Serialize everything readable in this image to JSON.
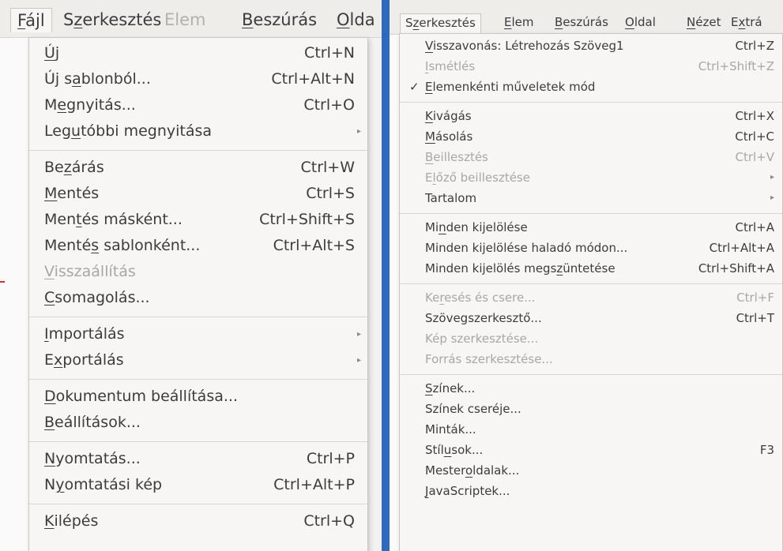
{
  "left": {
    "menubar": [
      {
        "label": "Fájl",
        "u": "F",
        "state": "active"
      },
      {
        "label": "Szerkesztés",
        "u": "z",
        "state": "normal"
      },
      {
        "label": "Elem",
        "u": "",
        "state": "dim"
      },
      {
        "label": "Beszúrás",
        "u": "B",
        "state": "normal"
      },
      {
        "label": "Olda",
        "u": "O",
        "state": "normal"
      }
    ],
    "menu": [
      {
        "label": "Új",
        "u": "Ú",
        "sc": "Ctrl+N"
      },
      {
        "label": "Új sablonból...",
        "u": "a",
        "sc": "Ctrl+Alt+N"
      },
      {
        "label": "Megnyitás...",
        "u": "e",
        "sc": "Ctrl+O"
      },
      {
        "label": "Legutóbbi megnyitása",
        "u": "u",
        "sub": true
      },
      {
        "sep": true
      },
      {
        "label": "Bezárás",
        "u": "z",
        "sc": "Ctrl+W"
      },
      {
        "label": "Mentés",
        "u": "M",
        "sc": "Ctrl+S"
      },
      {
        "label": "Mentés másként...",
        "u": "t",
        "sc": "Ctrl+Shift+S"
      },
      {
        "label": "Mentés sablonként...",
        "u": "s",
        "sc": "Ctrl+Alt+S"
      },
      {
        "label": "Visszaállítás",
        "u": "V",
        "disabled": true
      },
      {
        "label": "Csomagolás...",
        "u": "C"
      },
      {
        "sep": true
      },
      {
        "label": "Importálás",
        "u": "I",
        "sub": true
      },
      {
        "label": "Exportálás",
        "u": "x",
        "sub": true
      },
      {
        "sep": true
      },
      {
        "label": "Dokumentum beállítása...",
        "u": "D"
      },
      {
        "label": "Beállítások...",
        "u": "B"
      },
      {
        "sep": true
      },
      {
        "label": "Nyomtatás...",
        "u": "N",
        "sc": "Ctrl+P"
      },
      {
        "label": "Nyomtatási kép",
        "u": "y",
        "sc": "Ctrl+Alt+P"
      },
      {
        "sep": true
      },
      {
        "label": "Kilépés",
        "u": "K",
        "sc": "Ctrl+Q"
      }
    ]
  },
  "right": {
    "menubar": [
      {
        "label": "Szerkesztés",
        "u": "z",
        "state": "active"
      },
      {
        "label": "Elem",
        "u": "E",
        "state": "normal"
      },
      {
        "label": "Beszúrás",
        "u": "B",
        "state": "normal"
      },
      {
        "label": "Oldal",
        "u": "O",
        "state": "normal"
      },
      {
        "label": "Nézet",
        "u": "N",
        "state": "normal"
      },
      {
        "label": "Extrá",
        "u": "x",
        "state": "normal"
      }
    ],
    "menu": [
      {
        "label": "Visszavonás: Létrehozás Szöveg1",
        "u": "V",
        "sc": "Ctrl+Z"
      },
      {
        "label": "Ismétlés",
        "u": "I",
        "sc": "Ctrl+Shift+Z",
        "disabled": true
      },
      {
        "label": "Elemenkénti műveletek mód",
        "u": "E",
        "check": true
      },
      {
        "sep": true
      },
      {
        "label": "Kivágás",
        "u": "K",
        "sc": "Ctrl+X"
      },
      {
        "label": "Másolás",
        "u": "M",
        "sc": "Ctrl+C"
      },
      {
        "label": "Beillesztés",
        "u": "B",
        "sc": "Ctrl+V",
        "disabled": true
      },
      {
        "label": "Előző beillesztése",
        "u": "l",
        "disabled": true,
        "sub": true
      },
      {
        "label": "Tartalom",
        "u": "",
        "sub": true
      },
      {
        "sep": true
      },
      {
        "label": "Minden kijelölése",
        "u": "n",
        "sc": "Ctrl+A"
      },
      {
        "label": "Minden kijelölése haladó módon...",
        "u": "",
        "sc": "Ctrl+Alt+A"
      },
      {
        "label": "Minden kijelölés megszüntetése",
        "u": "z",
        "sc": "Ctrl+Shift+A"
      },
      {
        "sep": true
      },
      {
        "label": "Keresés és csere...",
        "u": "r",
        "sc": "Ctrl+F",
        "disabled": true
      },
      {
        "label": "Szövegszerkesztő...",
        "u": "",
        "sc": "Ctrl+T"
      },
      {
        "label": "Kép szerkesztése...",
        "u": "",
        "disabled": true
      },
      {
        "label": "Forrás szerkesztése...",
        "u": "",
        "disabled": true
      },
      {
        "sep": true
      },
      {
        "label": "Színek...",
        "u": "S"
      },
      {
        "label": "Színek cseréje...",
        "u": ""
      },
      {
        "label": "Minták...",
        "u": ""
      },
      {
        "label": "Stílusok...",
        "u": "u",
        "sc": "F3"
      },
      {
        "label": "Mesteroldalak...",
        "u": "o"
      },
      {
        "label": "JavaScriptek...",
        "u": "J"
      }
    ]
  },
  "colors": {
    "divider": "#2d69c0",
    "menu_bg": "#f7f6f4",
    "text": "#3c3c3c",
    "disabled": "#a9a7a3"
  },
  "icons": {
    "submenu": "submenu-arrow-icon",
    "check": "checkmark-icon"
  }
}
